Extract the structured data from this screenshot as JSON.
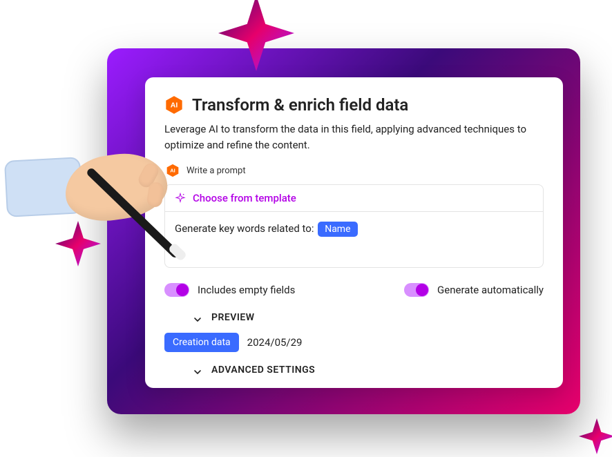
{
  "header": {
    "title": "Transform & enrich field data",
    "description": "Leverage AI to transform the data in this field, applying advanced techniques to optimize and refine the content."
  },
  "prompt": {
    "label": "Write a prompt",
    "template_link": "Choose from template",
    "body_prefix": "Generate key words related to:",
    "chip": "Name"
  },
  "toggles": {
    "empty_fields": {
      "label": "Includes empty fields",
      "on": true
    },
    "auto_generate": {
      "label": "Generate automatically",
      "on": true
    }
  },
  "sections": {
    "preview": {
      "title": "PREVIEW"
    },
    "advanced": {
      "title": "ADVANCED SETTINGS"
    }
  },
  "preview": {
    "badge": "Creation data",
    "value": "2024/05/29"
  },
  "icons": {
    "ai_hex": "ai-hex-icon",
    "template_sparkle": "template-sparkle-icon",
    "chevron_down": "chevron-down-icon"
  },
  "colors": {
    "accent_magenta": "#b300e6",
    "chip_blue": "#3a6bff",
    "grad_start": "#9b1cff",
    "grad_mid": "#3b0a7a",
    "grad_end": "#e6006b"
  }
}
